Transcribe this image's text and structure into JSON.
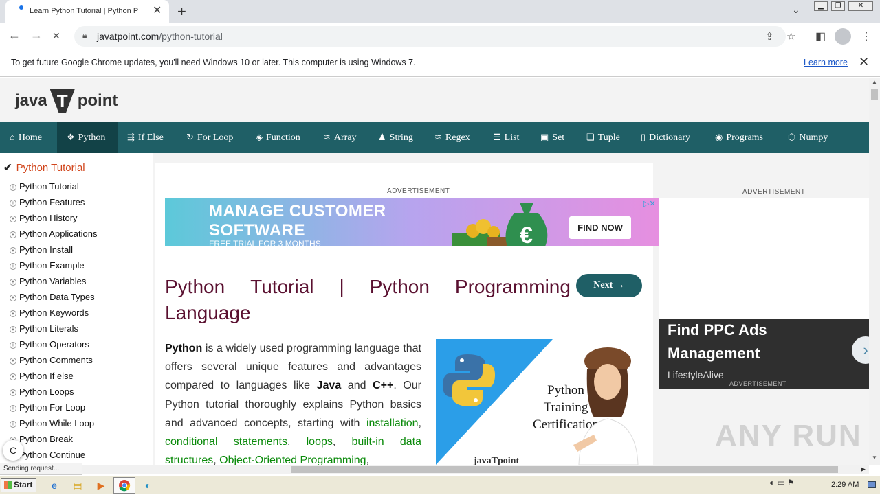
{
  "browser": {
    "tab_title": "Learn Python Tutorial | Python Programming",
    "url_host": "javatpoint.com",
    "url_path": "/python-tutorial",
    "new_tab": "+",
    "tab_close": "✕",
    "status_text": "Sending request..."
  },
  "infobar": {
    "message": "To get future Google Chrome updates, you'll need Windows 10 or later. This computer is using Windows 7.",
    "link": "Learn more"
  },
  "site": {
    "logo_left": "java",
    "logo_mid": "T",
    "logo_right": "point"
  },
  "menu": [
    {
      "label": "Home",
      "icon": "⌂",
      "active": false
    },
    {
      "label": "Python",
      "icon": "❖",
      "active": true
    },
    {
      "label": "If Else",
      "icon": "⇶",
      "active": false
    },
    {
      "label": "For Loop",
      "icon": "↻",
      "active": false
    },
    {
      "label": "Function",
      "icon": "◈",
      "active": false
    },
    {
      "label": "Array",
      "icon": "≋",
      "active": false
    },
    {
      "label": "String",
      "icon": "♟",
      "active": false
    },
    {
      "label": "Regex",
      "icon": "≋",
      "active": false
    },
    {
      "label": "List",
      "icon": "☰",
      "active": false
    },
    {
      "label": "Set",
      "icon": "▣",
      "active": false
    },
    {
      "label": "Tuple",
      "icon": "❏",
      "active": false
    },
    {
      "label": "Dictionary",
      "icon": "▯",
      "active": false
    },
    {
      "label": "Programs",
      "icon": "◉",
      "active": false
    },
    {
      "label": "Numpy",
      "icon": "⬡",
      "active": false
    }
  ],
  "sidebar": {
    "heading": "Python Tutorial",
    "items": [
      "Python Tutorial",
      "Python Features",
      "Python History",
      "Python Applications",
      "Python Install",
      "Python Example",
      "Python Variables",
      "Python Data Types",
      "Python Keywords",
      "Python Literals",
      "Python Operators",
      "Python Comments",
      "Python If else",
      "Python Loops",
      "Python For Loop",
      "Python While Loop",
      "Python Break",
      "Python Continue"
    ]
  },
  "main": {
    "ad_label": "ADVERTISEMENT",
    "banner": {
      "line1": "MANAGE CUSTOMER",
      "line2": "SOFTWARE",
      "line3": "FREE TRIAL FOR 3 MONTHS",
      "cta": "FIND NOW"
    },
    "title_words": [
      "Python",
      "Tutorial",
      "|",
      "Python",
      "Programming"
    ],
    "title_line2": "Language",
    "next_button": "Next →",
    "intro": {
      "b1": "Python",
      "t1": " is a widely used programming language that offers several unique features and advantages compared to languages like ",
      "b2": "Java",
      "t2": " and ",
      "b3": "C++",
      "t3": ". Our Python tutorial thoroughly explains Python basics and advanced concepts, starting with ",
      "l1": "installation",
      "t4": ", ",
      "l2": "conditional statements",
      "t5": ", ",
      "l3": "loops",
      "t6": ", ",
      "l4": "built-in data structures",
      "t7": ", ",
      "l5": "Object-Oriented Programming",
      "t8": ","
    },
    "image_text": "Python Training Certification",
    "image_brand": "javaTpoint"
  },
  "right_ad": {
    "ad_label": "ADVERTISEMENT",
    "line1": "Find PPC Ads",
    "line2": "Management",
    "source": "LifestyleAlive",
    "bottom_label": "ADVERTISEMENT"
  },
  "taskbar": {
    "start": "Start",
    "clock": "2:29 AM"
  },
  "watermark": "ANY RUN",
  "colors": {
    "menu_bg": "#1f5f66",
    "title": "#5a1030",
    "sidebar_heading": "#d1451b",
    "link_green": "#0a8a0a"
  }
}
